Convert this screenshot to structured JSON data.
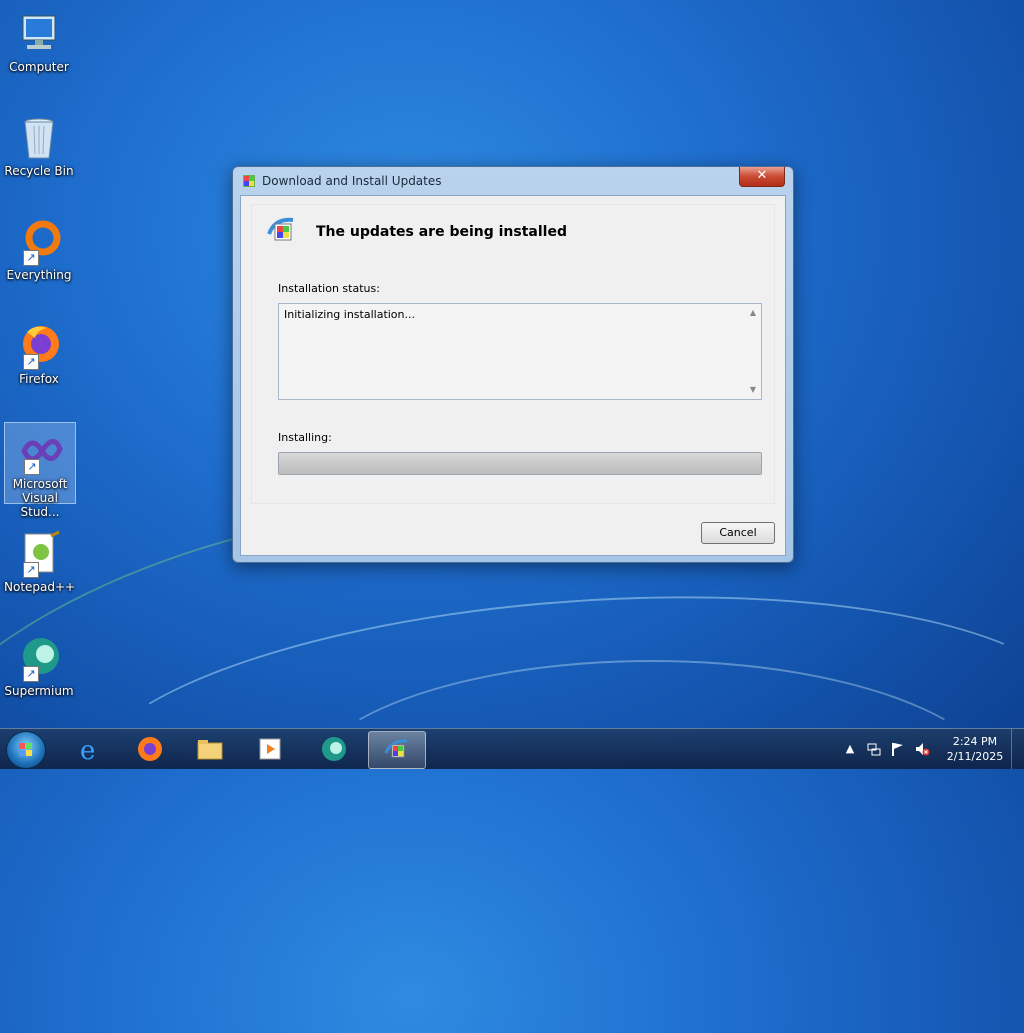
{
  "desktop": {
    "icons": [
      {
        "label": "Computer"
      },
      {
        "label": "Recycle Bin"
      },
      {
        "label": "Everything"
      },
      {
        "label": "Firefox"
      },
      {
        "label": "Microsoft Visual Stud..."
      },
      {
        "label": "Notepad++"
      },
      {
        "label": "Supermium"
      }
    ]
  },
  "dialog": {
    "title": "Download and Install Updates",
    "close_label": "✕",
    "heading": "The updates are being installed",
    "status_label": "Installation status:",
    "status_text": "Initializing installation...",
    "installing_label": "Installing:",
    "progress_percent": 0,
    "cancel_label": "Cancel"
  },
  "taskbar": {
    "pinned": [
      "internet-explorer-icon",
      "firefox-icon",
      "file-explorer-icon",
      "media-player-icon",
      "supermium-icon",
      "windows-update-icon"
    ],
    "clock": {
      "time": "2:24 PM",
      "date": "2/11/2025"
    }
  },
  "colors": {
    "desktop_blue": "#1f6fd0",
    "close_red": "#c94a32"
  }
}
